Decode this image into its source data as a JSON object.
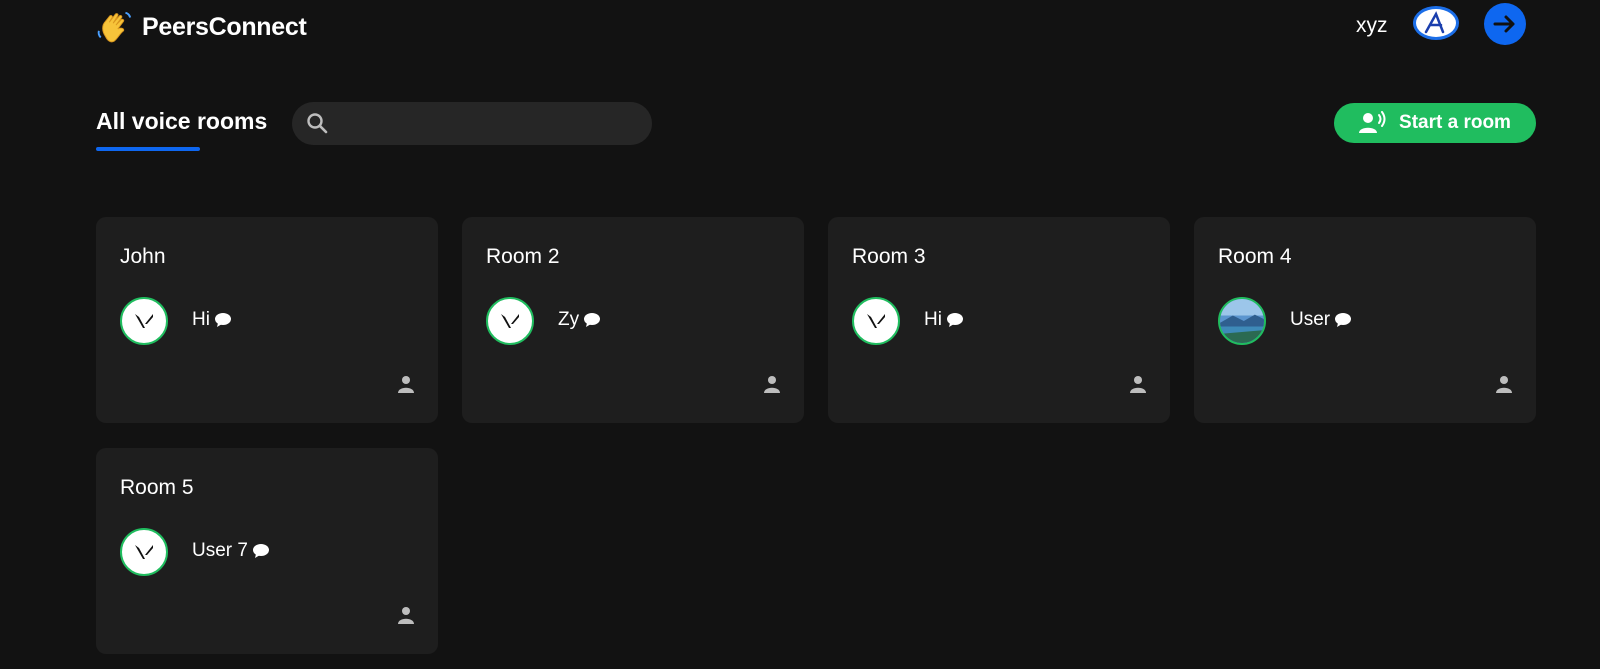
{
  "app": {
    "name": "PeersConnect"
  },
  "header": {
    "username": "xyz",
    "avatar_letter": "A"
  },
  "main": {
    "tab_title": "All voice rooms",
    "search": {
      "placeholder": "",
      "value": ""
    },
    "start_button_label": "Start a room"
  },
  "rooms": [
    {
      "title": "John",
      "speaker": "Hi"
    },
    {
      "title": "Room 2",
      "speaker": "Zy"
    },
    {
      "title": "Room 3",
      "speaker": "Hi"
    },
    {
      "title": "Room 4",
      "speaker": "User"
    },
    {
      "title": "Room 5",
      "speaker": "User 7"
    }
  ],
  "colors": {
    "accent_blue": "#0e67f0",
    "accent_green": "#20bd5f",
    "card_bg": "#1e1e1e",
    "page_bg": "#121212"
  }
}
